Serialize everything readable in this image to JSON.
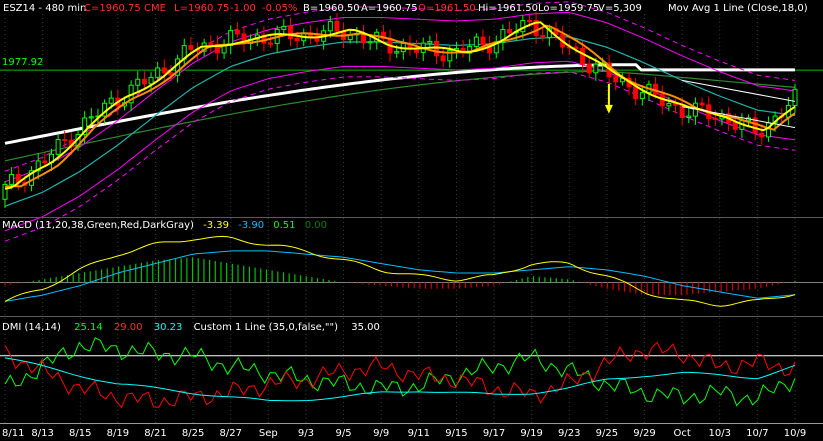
{
  "header": {
    "symbol": "ESZ14 - 480 min",
    "close": "C=1960.75",
    "exchange": "CME",
    "last": "L=1960.75",
    "change": "-1.00",
    "change_pct": "-0.05%",
    "bid": "B=1960.50",
    "ask": "A=1960.75",
    "open": "O=1961.50",
    "high": "Hi=1961.50",
    "low": "Lo=1959.75",
    "volume": "V=5,309",
    "study": "Mov Avg 1 Line (Close,18,0)"
  },
  "price_marker": "1977.92",
  "macd_legend": {
    "name": "MACD (11,20,38,Green,Red,DarkGray)",
    "v1": "-3.39",
    "v2": "-3.90",
    "v3": "0.51",
    "v4": "0.00"
  },
  "dmi_legend": {
    "name": "DMI (14,14)",
    "v1": "25.14",
    "v2": "29.00",
    "v3": "30.23",
    "custom": "Custom 1 Line (35,0,false,\"\")",
    "v4": "35.00"
  },
  "x_labels": [
    "8/11",
    "8/13",
    "8/15",
    "8/19",
    "8/21",
    "8/25",
    "8/27",
    "Sep",
    "9/3",
    "9/5",
    "9/9",
    "9/11",
    "9/15",
    "9/17",
    "9/19",
    "9/23",
    "9/25",
    "9/29",
    "Oct",
    "10/3",
    "10/7",
    "10/9"
  ],
  "colors": {
    "background": "#000000",
    "up_candle": "#00ff00",
    "down_candle": "#ff0000",
    "ma_white": "#ffffff",
    "ma_yellow": "#ffff00",
    "ma_orange": "#ff8c00",
    "band_magenta": "#ff00ff",
    "macd_line": "#ffff00",
    "signal_line": "#00bfff",
    "dmi_plus": "#00ff00",
    "dmi_minus": "#ff0000",
    "adx": "#00ffff",
    "level_line": "#ffffff",
    "marker_line": "#00c000"
  },
  "chart_data": [
    {
      "type": "candlestick",
      "title": "ESZ14 - 480 min",
      "x": [
        "8/11",
        "8/13",
        "8/15",
        "8/19",
        "8/21",
        "8/25",
        "8/27",
        "Sep",
        "9/3",
        "9/5",
        "9/9",
        "9/11",
        "9/15",
        "9/17",
        "9/19",
        "9/23",
        "9/25",
        "9/29",
        "Oct",
        "10/3",
        "10/7",
        "10/9"
      ],
      "close_approx": [
        1910,
        1925,
        1945,
        1962,
        1975,
        1990,
        1995,
        1997,
        1998,
        2000,
        1993,
        1990,
        1988,
        1995,
        2005,
        1990,
        1975,
        1965,
        1955,
        1952,
        1942,
        1960.75
      ],
      "series": [
        {
          "name": "Mov Avg 1 Line (Close,18,0)",
          "values": [
            1900,
            1908,
            1920,
            1935,
            1952,
            1968,
            1980,
            1987,
            1991,
            1994,
            1994,
            1993,
            1992,
            1993,
            1996,
            1997,
            1991,
            1982,
            1972,
            1963,
            1955,
            1952
          ]
        }
      ],
      "reference_lines": [
        1977.92
      ]
    },
    {
      "type": "bar",
      "title": "MACD (11,20,38,Green,Red,DarkGray)",
      "x": [
        "8/11",
        "8/13",
        "8/15",
        "8/19",
        "8/21",
        "8/25",
        "8/27",
        "Sep",
        "9/3",
        "9/5",
        "9/9",
        "9/11",
        "9/15",
        "9/17",
        "9/19",
        "9/23",
        "9/25",
        "9/29",
        "Oct",
        "10/3",
        "10/7",
        "10/9"
      ],
      "series": [
        {
          "name": "histogram",
          "values": [
            -1,
            1,
            3,
            5,
            7,
            8,
            6,
            4,
            2,
            0,
            -1,
            -2,
            -2,
            -1,
            2,
            1,
            -2,
            -4,
            -4,
            -3,
            -2,
            0.51
          ]
        },
        {
          "name": "macd",
          "values": [
            -6,
            -2,
            4,
            9,
            12,
            14,
            14,
            12,
            10,
            7,
            4,
            2,
            1,
            2,
            6,
            6,
            2,
            -3,
            -6,
            -7,
            -6,
            -3.39
          ]
        },
        {
          "name": "signal",
          "values": [
            -6,
            -4,
            -1,
            3,
            6,
            9,
            10,
            10,
            9,
            8,
            6,
            4,
            3,
            3,
            4,
            5,
            4,
            2,
            -1,
            -3,
            -5,
            -3.9
          ]
        }
      ],
      "reference_lines": [
        0.0
      ]
    },
    {
      "type": "line",
      "title": "DMI (14,14)",
      "x": [
        "8/11",
        "8/13",
        "8/15",
        "8/19",
        "8/21",
        "8/25",
        "8/27",
        "Sep",
        "9/3",
        "9/5",
        "9/9",
        "9/11",
        "9/15",
        "9/17",
        "9/19",
        "9/23",
        "9/25",
        "9/29",
        "Oct",
        "10/3",
        "10/7",
        "10/9"
      ],
      "series": [
        {
          "name": "+DI",
          "values": [
            20,
            30,
            40,
            38,
            36,
            35,
            30,
            27,
            24,
            22,
            20,
            21,
            26,
            30,
            34,
            28,
            22,
            18,
            16,
            18,
            15,
            25.14
          ]
        },
        {
          "name": "-DI",
          "values": [
            36,
            28,
            20,
            16,
            14,
            16,
            18,
            22,
            24,
            28,
            30,
            26,
            24,
            20,
            17,
            22,
            32,
            38,
            36,
            30,
            32,
            29.0
          ]
        },
        {
          "name": "ADX",
          "values": [
            34,
            30,
            26,
            22,
            20,
            18,
            16,
            14,
            15,
            16,
            18,
            19,
            18,
            17,
            18,
            20,
            24,
            26,
            27,
            26,
            25,
            30.23
          ]
        }
      ],
      "reference_lines": [
        35.0
      ]
    }
  ]
}
